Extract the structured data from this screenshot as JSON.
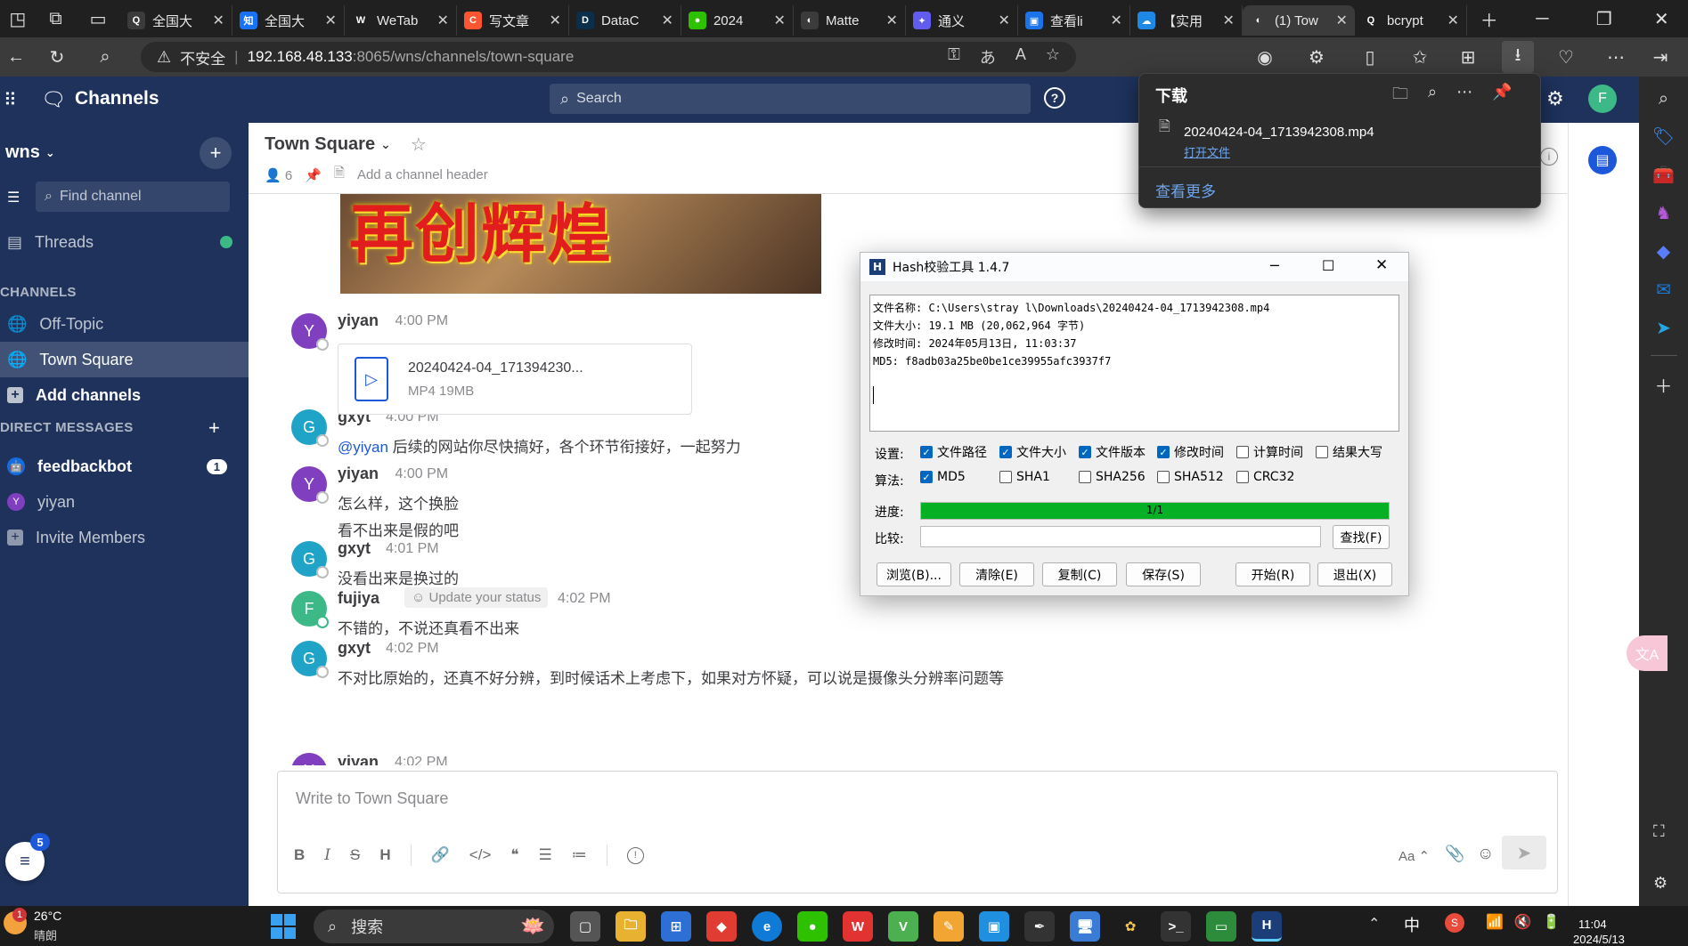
{
  "browser": {
    "tabs": [
      {
        "title": "全国大",
        "fav": "Q",
        "color": "#3b3b3b"
      },
      {
        "title": "全国大",
        "fav": "知",
        "color": "#1772f6"
      },
      {
        "title": "WeTab",
        "fav": "W",
        "color": "#202020"
      },
      {
        "title": "写文章",
        "fav": "C",
        "color": "#fc5531"
      },
      {
        "title": "DataC",
        "fav": "D",
        "color": "#0b2f4a"
      },
      {
        "title": "2024",
        "fav": "●",
        "color": "#2dc100"
      },
      {
        "title": "Matte",
        "fav": "◐",
        "color": "#3b3b3b"
      },
      {
        "title": "通义",
        "fav": "✦",
        "color": "#615ced"
      },
      {
        "title": "查看li",
        "fav": "▣",
        "color": "#1a73e8"
      },
      {
        "title": "【实用",
        "fav": "☁",
        "color": "#1e88e5"
      },
      {
        "title": "(1) Tow",
        "fav": "◐",
        "color": "#3b3b3b"
      },
      {
        "title": "bcrypt",
        "fav": "Q",
        "color": "#202020"
      }
    ],
    "insecure_label": "不安全",
    "url_host": "192.168.48.133",
    "url_rest": ":8065/wns/channels/town-square"
  },
  "mm": {
    "app_name": "Channels",
    "search_placeholder": "Search",
    "user_initial": "F",
    "team_name": "wns",
    "find_channel": "Find channel",
    "threads": "Threads",
    "channels_header": "CHANNELS",
    "channels": [
      "Off-Topic",
      "Town Square"
    ],
    "add_channels": "Add channels",
    "dm_header": "DIRECT MESSAGES",
    "dms": [
      {
        "name": "feedbackbot",
        "badge": "1"
      },
      {
        "name": "yiyan",
        "badge": ""
      }
    ],
    "invite": "Invite Members",
    "notif_count": "5",
    "channel_title": "Town Square",
    "member_count": "6",
    "add_header": "Add a channel header",
    "attachment": {
      "name": "20240424-04_171394230...",
      "meta": "MP4 19MB"
    },
    "posts": [
      {
        "user": "yiyan",
        "initial": "Y",
        "color": "#7f3fbf",
        "time": "4:00 PM",
        "lines": []
      },
      {
        "user": "gxyt",
        "initial": "G",
        "color": "#1fa4c8",
        "time": "4:00 PM",
        "mention": "@yiyan",
        "lines": [
          " 后续的网站你尽快搞好，各个环节衔接好，一起努力"
        ]
      },
      {
        "user": "yiyan",
        "initial": "Y",
        "color": "#7f3fbf",
        "time": "4:00 PM",
        "lines": [
          "怎么样，这个换脸",
          "看不出来是假的吧"
        ]
      },
      {
        "user": "gxyt",
        "initial": "G",
        "color": "#1fa4c8",
        "time": "4:01 PM",
        "lines": [
          "没看出来是换过的"
        ]
      },
      {
        "user": "fujiya",
        "initial": "F",
        "color": "#3db887",
        "time": "4:02 PM",
        "status": "Update your status",
        "lines": [
          "不错的，不说还真看不出来"
        ]
      },
      {
        "user": "gxyt",
        "initial": "G",
        "color": "#1fa4c8",
        "time": "4:02 PM",
        "lines": [
          "不对比原始的，还真不好分辨，到时候话术上考虑下，如果对方怀疑，可以说是摄像头分辨率问题等"
        ]
      }
    ],
    "partial_user": "yiyan",
    "partial_time": "4:02 PM",
    "composer_placeholder": "Write to Town Square",
    "format_label": "Aa"
  },
  "download": {
    "title": "下载",
    "file": "20240424-04_1713942308.mp4",
    "open": "打开文件",
    "more": "查看更多"
  },
  "hash": {
    "title": "Hash校验工具 1.4.7",
    "info": [
      "文件名称: C:\\Users\\stray l\\Downloads\\20240424-04_1713942308.mp4",
      "文件大小: 19.1 MB (20,062,964 字节)",
      "修改时间: 2024年05月13日, 11:03:37",
      "MD5: f8adb03a25be0be1ce39955afc3937f7"
    ],
    "settings_label": "设置:",
    "settings": [
      {
        "label": "文件路径",
        "on": true
      },
      {
        "label": "文件大小",
        "on": true
      },
      {
        "label": "文件版本",
        "on": true
      },
      {
        "label": "修改时间",
        "on": true
      },
      {
        "label": "计算时间",
        "on": false
      },
      {
        "label": "结果大写",
        "on": false
      }
    ],
    "algo_label": "算法:",
    "algos": [
      {
        "label": "MD5",
        "on": true
      },
      {
        "label": "SHA1",
        "on": false
      },
      {
        "label": "SHA256",
        "on": false
      },
      {
        "label": "SHA512",
        "on": false
      },
      {
        "label": "CRC32",
        "on": false
      }
    ],
    "progress_label": "进度:",
    "progress_text": "1/1",
    "progress": 1.0,
    "compare_label": "比较:",
    "find_btn": "查找(F)",
    "buttons": [
      "浏览(B)...",
      "清除(E)",
      "复制(C)",
      "保存(S)",
      "开始(R)",
      "退出(X)"
    ]
  },
  "taskbar": {
    "temp": "26°C",
    "weather": "晴朗",
    "weather_badge": "1",
    "search": "搜索",
    "ime": "中",
    "time": "11:04",
    "date": "2024/5/13"
  }
}
